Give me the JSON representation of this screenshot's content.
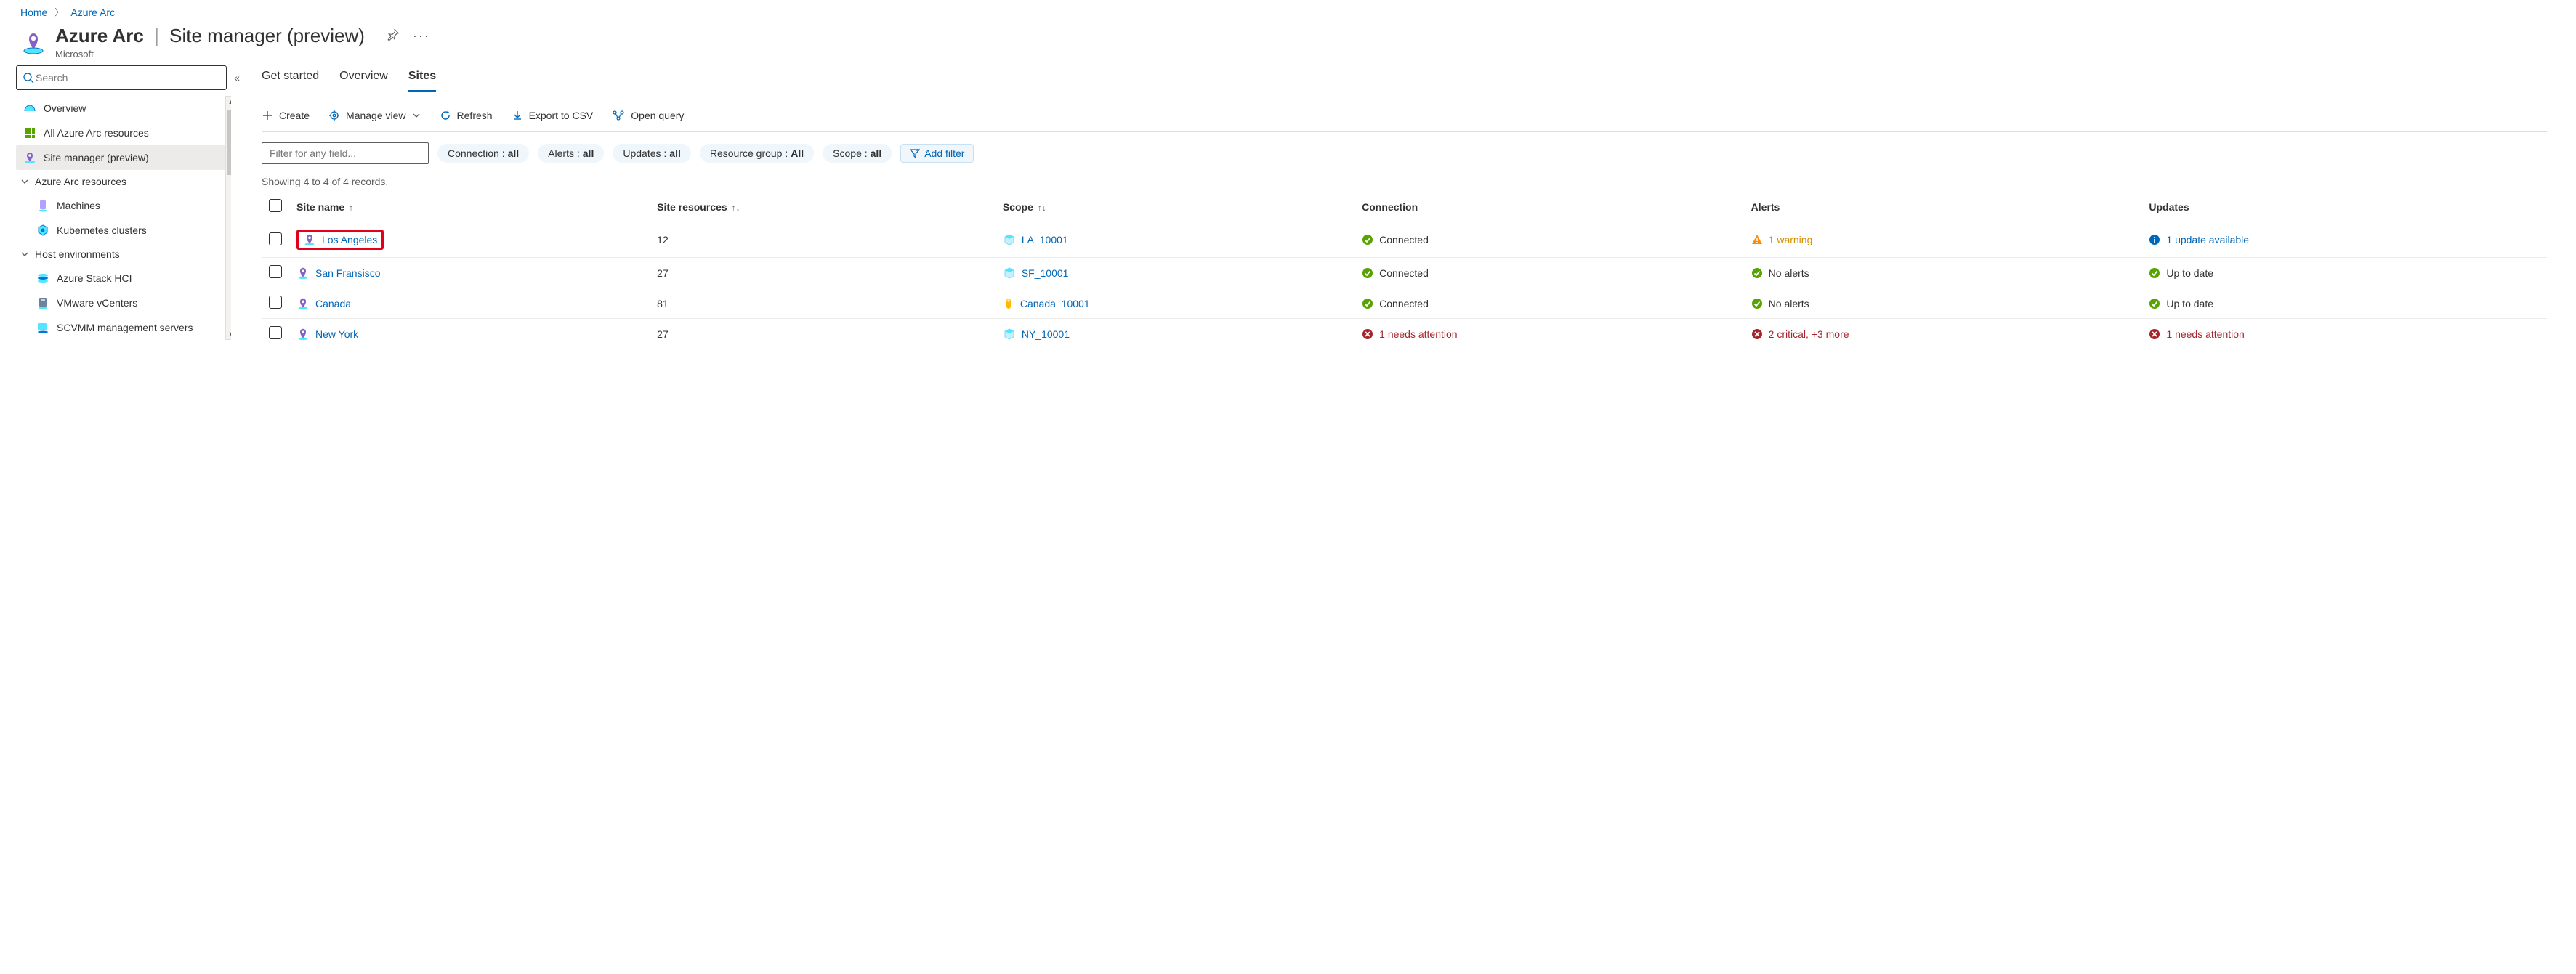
{
  "breadcrumb": {
    "home": "Home",
    "current": "Azure Arc"
  },
  "header": {
    "product": "Azure Arc",
    "page": "Site manager (preview)",
    "publisher": "Microsoft"
  },
  "sidebar": {
    "search_placeholder": "Search",
    "overview": "Overview",
    "all_resources": "All Azure Arc resources",
    "site_manager": "Site manager (preview)",
    "group_resources": "Azure Arc resources",
    "machines": "Machines",
    "kubernetes": "Kubernetes clusters",
    "group_host": "Host environments",
    "stack_hci": "Azure Stack HCI",
    "vmware": "VMware vCenters",
    "scvmm": "SCVMM management servers"
  },
  "tabs": {
    "get_started": "Get started",
    "overview": "Overview",
    "sites": "Sites"
  },
  "toolbar": {
    "create": "Create",
    "manage_view": "Manage view",
    "refresh": "Refresh",
    "export": "Export to CSV",
    "open_query": "Open query"
  },
  "filters": {
    "input_placeholder": "Filter for any field...",
    "conn_k": "Connection : ",
    "conn_v": "all",
    "alerts_k": "Alerts : ",
    "alerts_v": "all",
    "updates_k": "Updates : ",
    "updates_v": "all",
    "rg_k": "Resource group : ",
    "rg_v": "All",
    "scope_k": "Scope : ",
    "scope_v": "all",
    "add_filter": "Add filter"
  },
  "records_text": "Showing 4 to 4 of 4 records.",
  "columns": {
    "site_name": "Site name",
    "site_resources": "Site resources",
    "scope": "Scope",
    "connection": "Connection",
    "alerts": "Alerts",
    "updates": "Updates"
  },
  "rows": [
    {
      "name": "Los Angeles",
      "highlight": true,
      "resources": "12",
      "scope": "LA_10001",
      "scope_icon": "rg",
      "connection_text": "Connected",
      "connection_status": "ok",
      "alerts_text": "1 warning",
      "alerts_status": "warn",
      "updates_text": "1 update available",
      "updates_status": "info"
    },
    {
      "name": "San Fransisco",
      "highlight": false,
      "resources": "27",
      "scope": "SF_10001",
      "scope_icon": "rg",
      "connection_text": "Connected",
      "connection_status": "ok",
      "alerts_text": "No alerts",
      "alerts_status": "ok",
      "updates_text": "Up to date",
      "updates_status": "ok"
    },
    {
      "name": "Canada",
      "highlight": false,
      "resources": "81",
      "scope": "Canada_10001",
      "scope_icon": "sub",
      "connection_text": "Connected",
      "connection_status": "ok",
      "alerts_text": "No alerts",
      "alerts_status": "ok",
      "updates_text": "Up to date",
      "updates_status": "ok"
    },
    {
      "name": "New York",
      "highlight": false,
      "resources": "27",
      "scope": "NY_10001",
      "scope_icon": "rg",
      "connection_text": "1 needs attention",
      "connection_status": "err",
      "alerts_text": "2 critical, +3 more",
      "alerts_status": "err",
      "updates_text": "1 needs attention",
      "updates_status": "err"
    }
  ]
}
